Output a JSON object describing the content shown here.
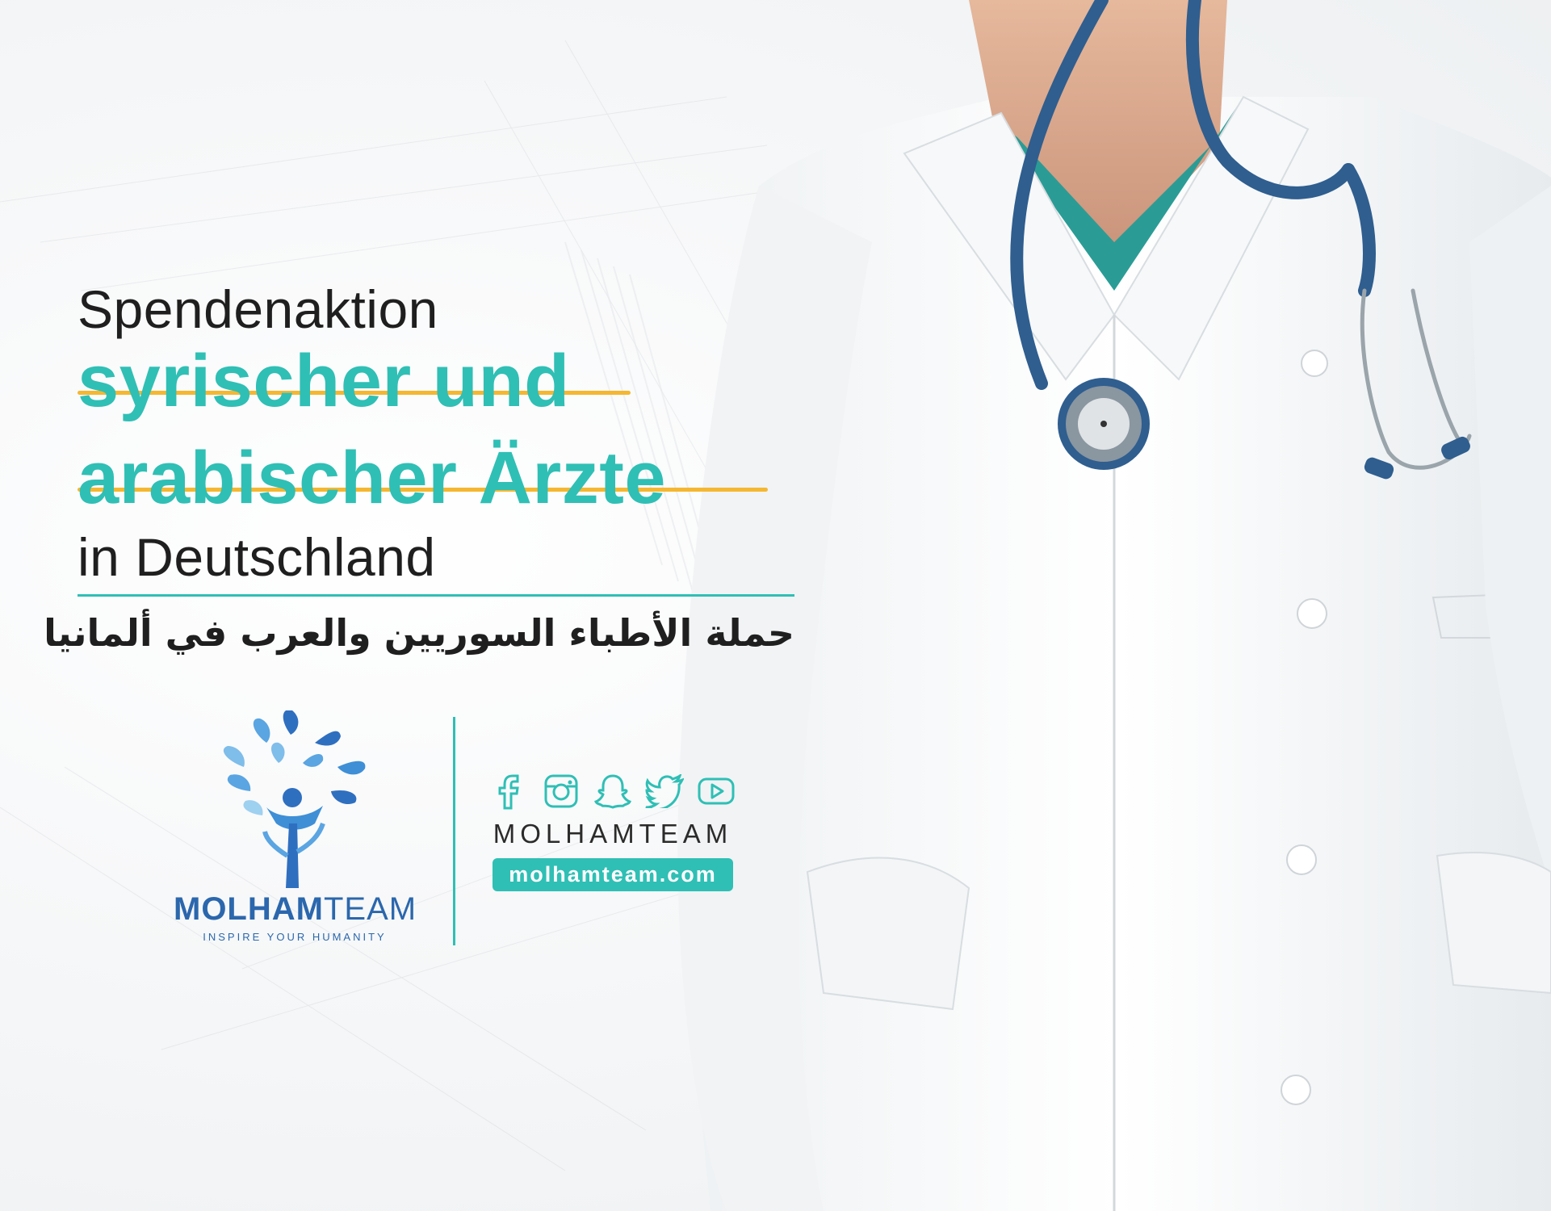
{
  "headline": {
    "line1": "Spendenaktion",
    "line2": "syrischer und",
    "line3": "arabischer Ärzte",
    "line4": "in Deutschland",
    "arabic": "حملة الأطباء السوريين والعرب في ألمانيا"
  },
  "brand": {
    "name_bold": "MOLHAM",
    "name_light": "TEAM",
    "tagline": "INSPIRE YOUR HUMANITY"
  },
  "social": {
    "icons": [
      "facebook-icon",
      "instagram-icon",
      "snapchat-icon",
      "twitter-icon",
      "youtube-icon"
    ],
    "handle": "MOLHAMTEAM",
    "website": "molhamteam.com"
  },
  "colors": {
    "teal": "#2fbfb5",
    "yellow": "#f5b731",
    "blue": "#2b67ad",
    "dark": "#1f1f1f"
  }
}
